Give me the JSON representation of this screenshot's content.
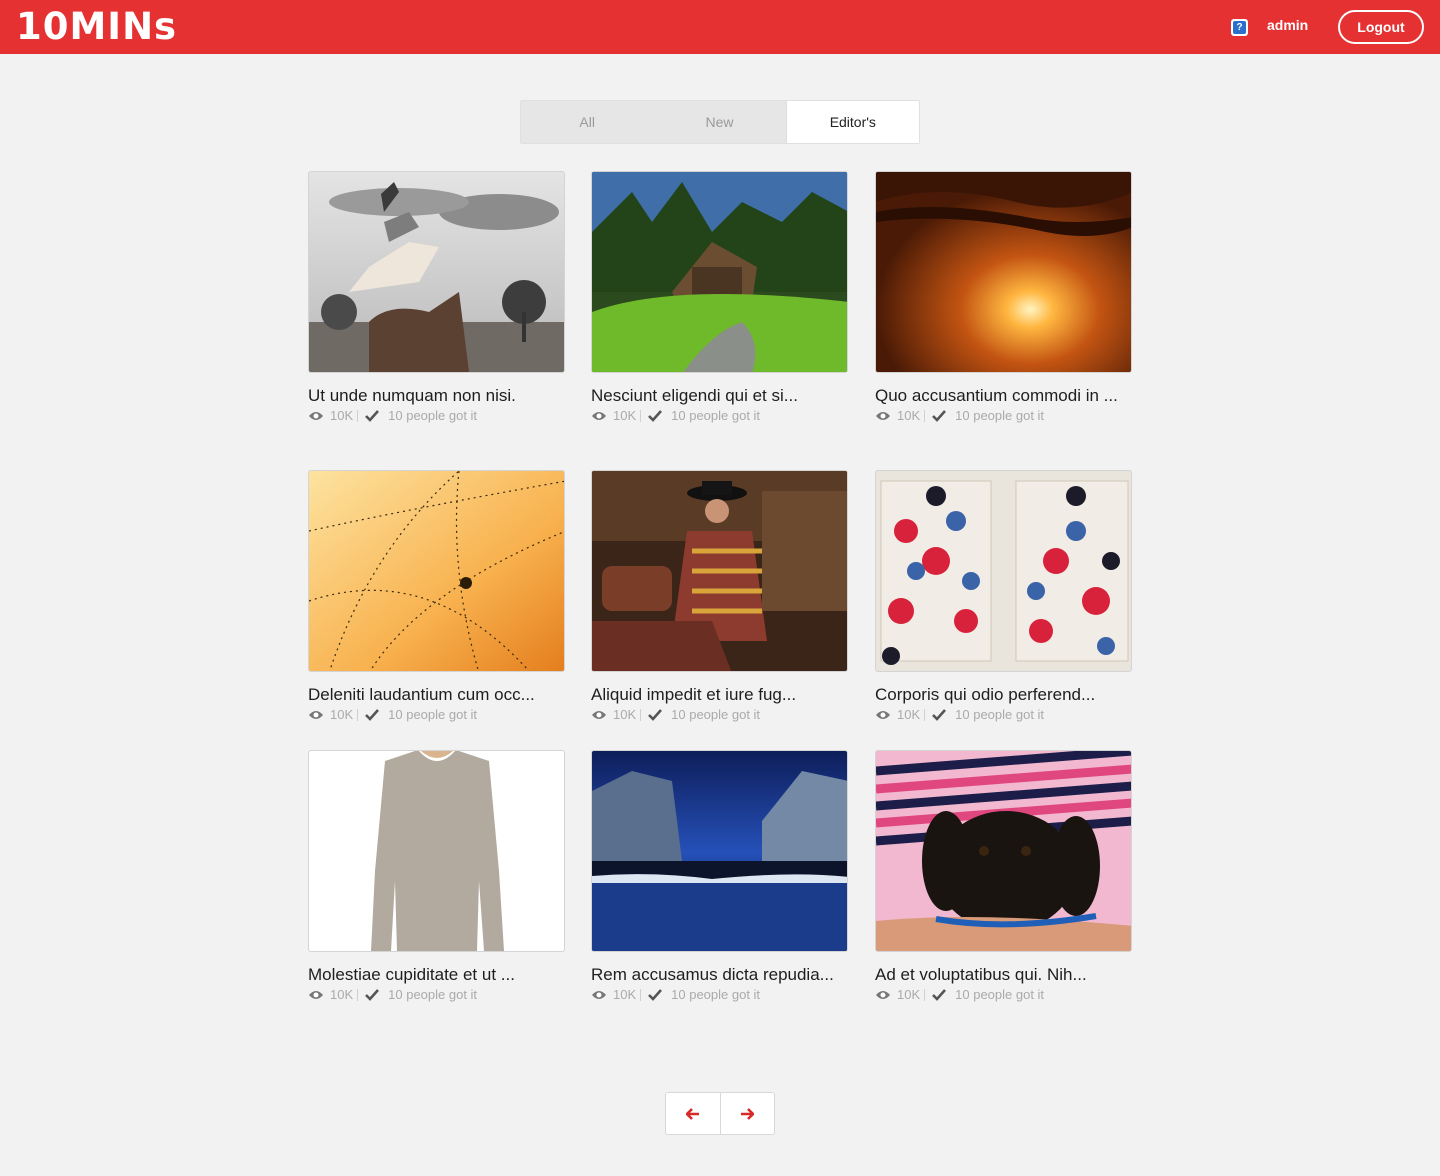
{
  "app": {
    "logo": "10MINs"
  },
  "header": {
    "user": "admin",
    "logout_label": "Logout",
    "help_icon": "help-icon",
    "accent": "#e53131"
  },
  "tabs": [
    {
      "label": "All",
      "active": false
    },
    {
      "label": "New",
      "active": false
    },
    {
      "label": "Editor's",
      "active": true
    }
  ],
  "cards": [
    {
      "title": "Ut unde numquam non nisi.",
      "views": "10K",
      "got_it": "10 people got it",
      "image": "animals-stacked"
    },
    {
      "title": "Nesciunt eligendi qui et si...",
      "views": "10K",
      "got_it": "10 people got it",
      "image": "forest-mill"
    },
    {
      "title": "Quo accusantium commodi in ...",
      "views": "10K",
      "got_it": "10 people got it",
      "image": "sunset"
    },
    {
      "title": "Deleniti laudantium cum occ...",
      "views": "10K",
      "got_it": "10 people got it",
      "image": "spider-web-dew"
    },
    {
      "title": "Aliquid impedit et iure fug...",
      "views": "10K",
      "got_it": "10 people got it",
      "image": "woman-hat"
    },
    {
      "title": "Corporis qui odio perferend...",
      "views": "10K",
      "got_it": "10 people got it",
      "image": "berries"
    },
    {
      "title": "Molestiae cupiditate et ut ...",
      "views": "10K",
      "got_it": "10 people got it",
      "image": "sweater"
    },
    {
      "title": "Rem accusamus dicta repudia...",
      "views": "10K",
      "got_it": "10 people got it",
      "image": "mountain-lake"
    },
    {
      "title": "Ad et voluptatibus qui. Nih...",
      "views": "10K",
      "got_it": "10 people got it",
      "image": "puppy"
    }
  ],
  "pager": {
    "prev_icon": "arrow-left-icon",
    "next_icon": "arrow-right-icon"
  }
}
